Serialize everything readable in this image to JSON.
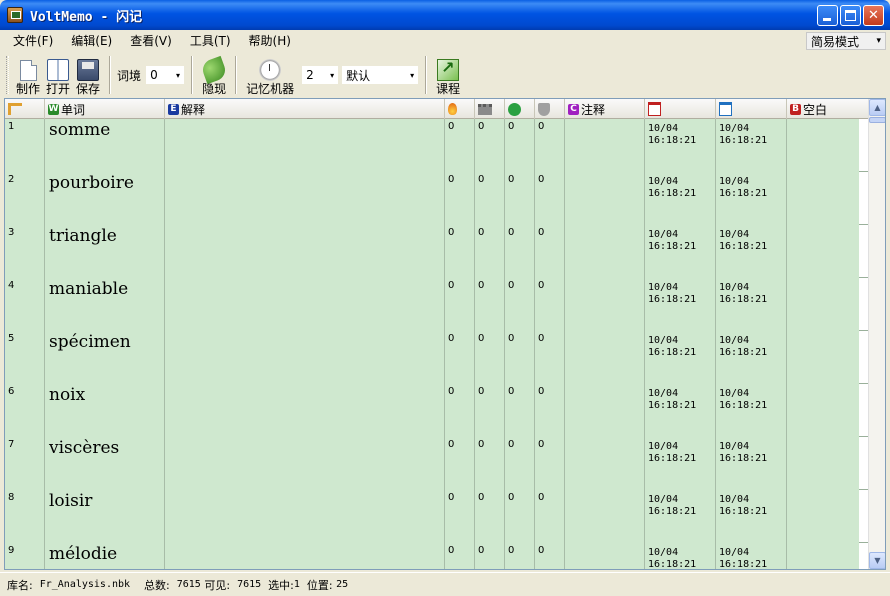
{
  "window": {
    "title": "VoltMemo - 闪记",
    "min_glyph": "_",
    "max_glyph": "□",
    "close_glyph": "✕"
  },
  "menu": {
    "items": [
      "文件(F)",
      "编辑(E)",
      "查看(V)",
      "工具(T)",
      "帮助(H)"
    ],
    "mode": "简易模式",
    "mode_arrow": "▾"
  },
  "toolbar": {
    "make": "制作",
    "open": "打开",
    "save": "保存",
    "context_label": "词境",
    "context_value": "0",
    "reveal": "隐现",
    "memory_machine": "记忆机器",
    "machine_value": "2",
    "preset_value": "默认",
    "course": "课程",
    "combo_arrow": "▾"
  },
  "grid": {
    "columns": {
      "word_badge": "W",
      "word": "单词",
      "explain_badge": "E",
      "explain": "解释",
      "note_badge": "C",
      "note": "注释",
      "blank_badge": "B",
      "blank": "空白"
    },
    "rows": [
      {
        "no": "1",
        "word": "somme",
        "s1": "0",
        "s2": "0",
        "s3": "0",
        "s4": "0",
        "d1a": "10/04",
        "d1b": "16:18:21",
        "d2a": "10/04",
        "d2b": "16:18:21"
      },
      {
        "no": "2",
        "word": "pourboire",
        "s1": "0",
        "s2": "0",
        "s3": "0",
        "s4": "0",
        "d1a": "10/04",
        "d1b": "16:18:21",
        "d2a": "10/04",
        "d2b": "16:18:21"
      },
      {
        "no": "3",
        "word": "triangle",
        "s1": "0",
        "s2": "0",
        "s3": "0",
        "s4": "0",
        "d1a": "10/04",
        "d1b": "16:18:21",
        "d2a": "10/04",
        "d2b": "16:18:21"
      },
      {
        "no": "4",
        "word": "maniable",
        "s1": "0",
        "s2": "0",
        "s3": "0",
        "s4": "0",
        "d1a": "10/04",
        "d1b": "16:18:21",
        "d2a": "10/04",
        "d2b": "16:18:21"
      },
      {
        "no": "5",
        "word": "spécimen",
        "s1": "0",
        "s2": "0",
        "s3": "0",
        "s4": "0",
        "d1a": "10/04",
        "d1b": "16:18:21",
        "d2a": "10/04",
        "d2b": "16:18:21"
      },
      {
        "no": "6",
        "word": "noix",
        "s1": "0",
        "s2": "0",
        "s3": "0",
        "s4": "0",
        "d1a": "10/04",
        "d1b": "16:18:21",
        "d2a": "10/04",
        "d2b": "16:18:21"
      },
      {
        "no": "7",
        "word": "viscères",
        "s1": "0",
        "s2": "0",
        "s3": "0",
        "s4": "0",
        "d1a": "10/04",
        "d1b": "16:18:21",
        "d2a": "10/04",
        "d2b": "16:18:21"
      },
      {
        "no": "8",
        "word": "loisir",
        "s1": "0",
        "s2": "0",
        "s3": "0",
        "s4": "0",
        "d1a": "10/04",
        "d1b": "16:18:21",
        "d2a": "10/04",
        "d2b": "16:18:21"
      },
      {
        "no": "9",
        "word": "mélodie",
        "s1": "0",
        "s2": "0",
        "s3": "0",
        "s4": "0",
        "d1a": "10/04",
        "d1b": "16:18:21",
        "d2a": "10/04",
        "d2b": "16:18:21"
      }
    ]
  },
  "status": {
    "lib_label": "库名:",
    "lib_value": "Fr_Analysis.nbk",
    "total_label": "总数:",
    "total_value": "7615",
    "visible_label": "可见:",
    "visible_value": "7615",
    "selected_label": "选中:",
    "selected_value": "1",
    "position_label": "位置:",
    "position_value": "25"
  },
  "colors": {
    "row_bg": "#cfe8cf",
    "title_blue": "#0054e3",
    "word_badge": "#2a8a2a",
    "explain_badge": "#1a3aa0",
    "note_badge": "#a020c0",
    "blank_badge": "#c02020"
  },
  "icons": [
    "app-icon",
    "doc-icon",
    "book-icon",
    "disk-icon",
    "leaf-icon",
    "clock-icon",
    "chart-icon",
    "sort-icon",
    "flame-icon",
    "castle-icon",
    "refresh-icon",
    "shield-icon",
    "calendar-x-icon",
    "calendar-check-icon"
  ]
}
